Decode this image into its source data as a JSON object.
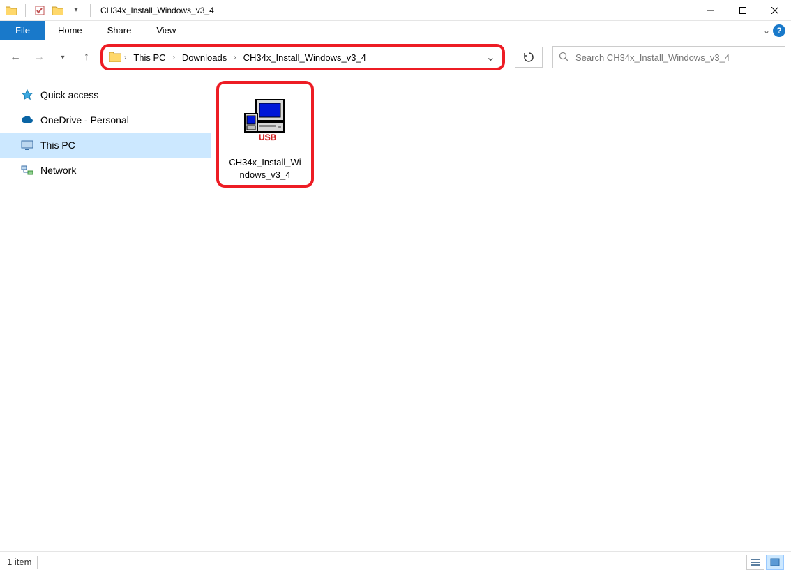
{
  "titlebar": {
    "window_title": "CH34x_Install_Windows_v3_4"
  },
  "menu": {
    "file": "File",
    "home": "Home",
    "share": "Share",
    "view": "View"
  },
  "breadcrumb": {
    "items": [
      "This PC",
      "Downloads",
      "CH34x_Install_Windows_v3_4"
    ]
  },
  "search": {
    "placeholder": "Search CH34x_Install_Windows_v3_4"
  },
  "sidebar": {
    "items": [
      {
        "label": "Quick access"
      },
      {
        "label": "OneDrive - Personal"
      },
      {
        "label": "This PC"
      },
      {
        "label": "Network"
      }
    ],
    "selected_index": 2
  },
  "files": {
    "items": [
      {
        "name_line1": "CH34x_Install_Wi",
        "name_line2": "ndows_v3_4"
      }
    ]
  },
  "statusbar": {
    "item_count": "1 item"
  }
}
